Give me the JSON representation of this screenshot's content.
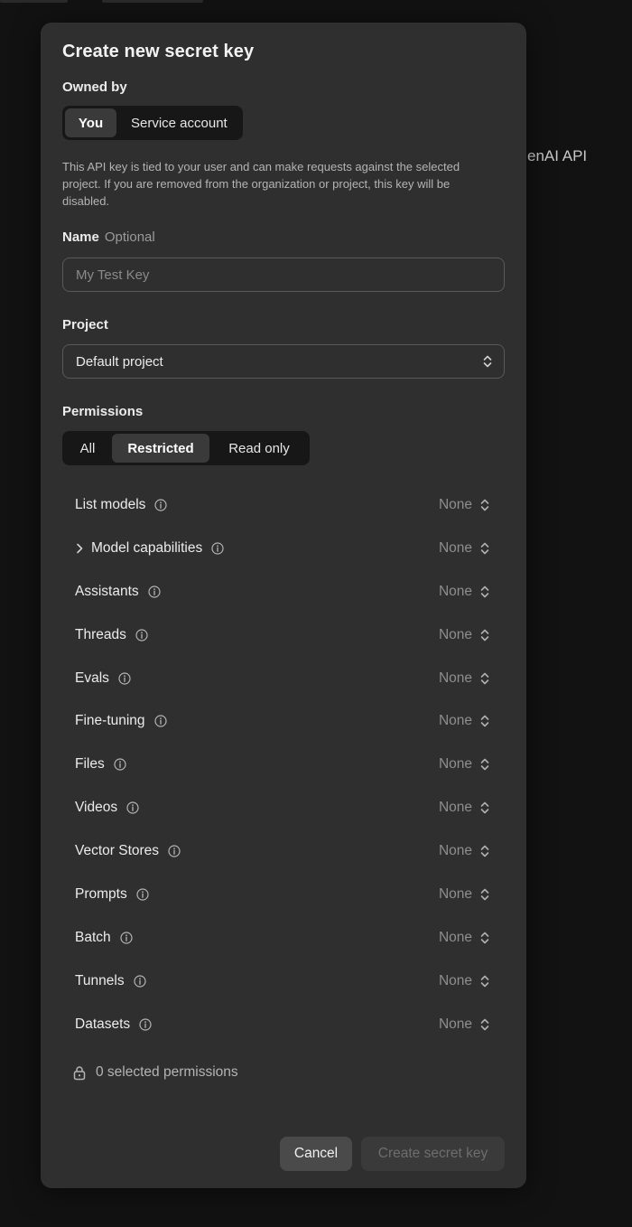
{
  "background": {
    "partial_text": "enAI API"
  },
  "modal": {
    "title": "Create new secret key",
    "owned_by": {
      "label": "Owned by",
      "options": [
        {
          "label": "You",
          "active": true
        },
        {
          "label": "Service account",
          "active": false
        }
      ]
    },
    "description": "This API key is tied to your user and can make requests against the selected project. If you are removed from the organization or project, this key will be disabled.",
    "name_field": {
      "label": "Name",
      "optional": "Optional",
      "value": "",
      "placeholder": "My Test Key"
    },
    "project": {
      "label": "Project",
      "selected": "Default project"
    },
    "permissions": {
      "label": "Permissions",
      "options": [
        {
          "label": "All",
          "active": false
        },
        {
          "label": "Restricted",
          "active": true
        },
        {
          "label": "Read only",
          "active": false
        }
      ],
      "items": [
        {
          "label": "List models",
          "value": "None",
          "expandable": false
        },
        {
          "label": "Model capabilities",
          "value": "None",
          "expandable": true
        },
        {
          "label": "Assistants",
          "value": "None",
          "expandable": false
        },
        {
          "label": "Threads",
          "value": "None",
          "expandable": false
        },
        {
          "label": "Evals",
          "value": "None",
          "expandable": false
        },
        {
          "label": "Fine-tuning",
          "value": "None",
          "expandable": false
        },
        {
          "label": "Files",
          "value": "None",
          "expandable": false
        },
        {
          "label": "Videos",
          "value": "None",
          "expandable": false
        },
        {
          "label": "Vector Stores",
          "value": "None",
          "expandable": false
        },
        {
          "label": "Prompts",
          "value": "None",
          "expandable": false
        },
        {
          "label": "Batch",
          "value": "None",
          "expandable": false
        },
        {
          "label": "Tunnels",
          "value": "None",
          "expandable": false
        },
        {
          "label": "Datasets",
          "value": "None",
          "expandable": false
        }
      ],
      "selected_count_text": "0 selected permissions"
    },
    "buttons": {
      "cancel": "Cancel",
      "create": "Create secret key"
    }
  },
  "colors": {
    "page_bg": "#121212",
    "modal_bg": "#2f2f2f",
    "segment_bg": "#171717",
    "segment_active_bg": "#3a3a3a",
    "muted_text": "#8e8e8e",
    "disabled_text": "#6d6d6d"
  },
  "icons": [
    "info-icon",
    "chevron-right-icon",
    "updown-chevron-icon",
    "lock-icon"
  ]
}
